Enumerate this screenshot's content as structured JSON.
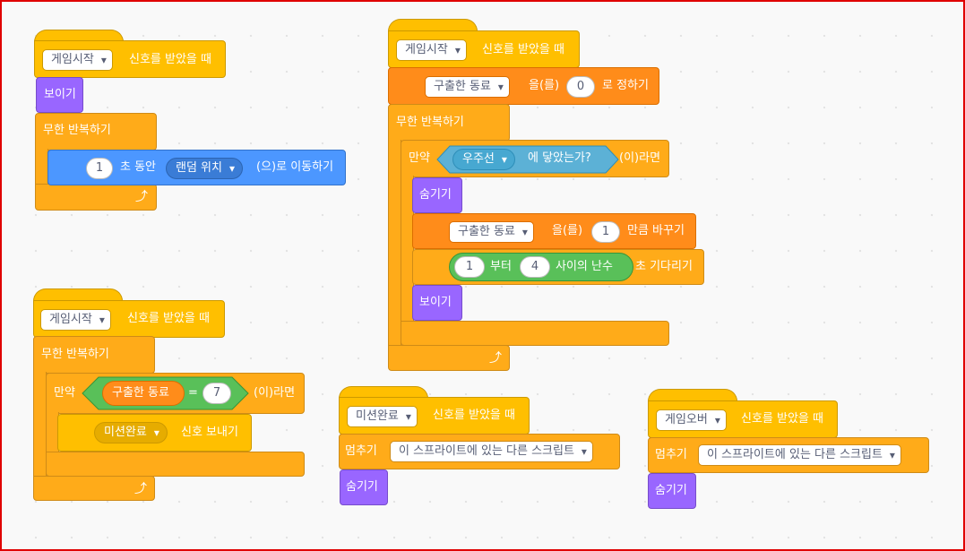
{
  "script1": {
    "event_msg": "게임시작",
    "event_suffix": "신호를 받았을 때",
    "show_label": "보이기",
    "forever_label": "무한 반복하기",
    "glide_seconds": "1",
    "glide_mid": "초 동안",
    "glide_target": "랜덤 위치",
    "glide_suffix": "(으)로 이동하기"
  },
  "script2": {
    "event_msg": "게임시작",
    "event_suffix": "신호를 받았을 때",
    "setvar_name": "구출한 동료",
    "setvar_mid": "을(를)",
    "setvar_value": "0",
    "setvar_suffix": "로 정하기",
    "forever_label": "무한 반복하기",
    "if_label": "만약",
    "touch_target": "우주선",
    "touch_suffix": "에 닿았는가?",
    "then_label": "(이)라면",
    "hide_label": "숨기기",
    "changevar_name": "구출한 동료",
    "changevar_mid": "을(를)",
    "changevar_value": "1",
    "changevar_suffix": "만큼 바꾸기",
    "random_from": "1",
    "random_mid": "부터",
    "random_to": "4",
    "random_suffix": "사이의 난수",
    "wait_suffix": "초 기다리기",
    "show_label": "보이기"
  },
  "script3": {
    "event_msg": "게임시작",
    "event_suffix": "신호를 받았을 때",
    "forever_label": "무한 반복하기",
    "if_label": "만약",
    "var_name": "구출한 동료",
    "eq_sign": "=",
    "eq_value": "7",
    "then_label": "(이)라면",
    "broadcast_msg": "미션완료",
    "broadcast_suffix": "신호 보내기"
  },
  "script4": {
    "event_msg": "미션완료",
    "event_suffix": "신호를 받았을 때",
    "stop_label": "멈추기",
    "stop_option": "이 스프라이트에 있는 다른 스크립트",
    "hide_label": "숨기기"
  },
  "script5": {
    "event_msg": "게임오버",
    "event_suffix": "신호를 받았을 때",
    "stop_label": "멈추기",
    "stop_option": "이 스프라이트에 있는 다른 스크립트",
    "hide_label": "숨기기"
  },
  "icons": {
    "repeat_arrow": "repeat-arrow-icon"
  },
  "colors": {
    "events": "#ffbf00",
    "control": "#ffab19",
    "looks": "#9966ff",
    "motion": "#4c97ff",
    "variables": "#ff8c1a",
    "operators": "#59c059",
    "sensing": "#5cb1d6",
    "frame": "#e00000"
  }
}
